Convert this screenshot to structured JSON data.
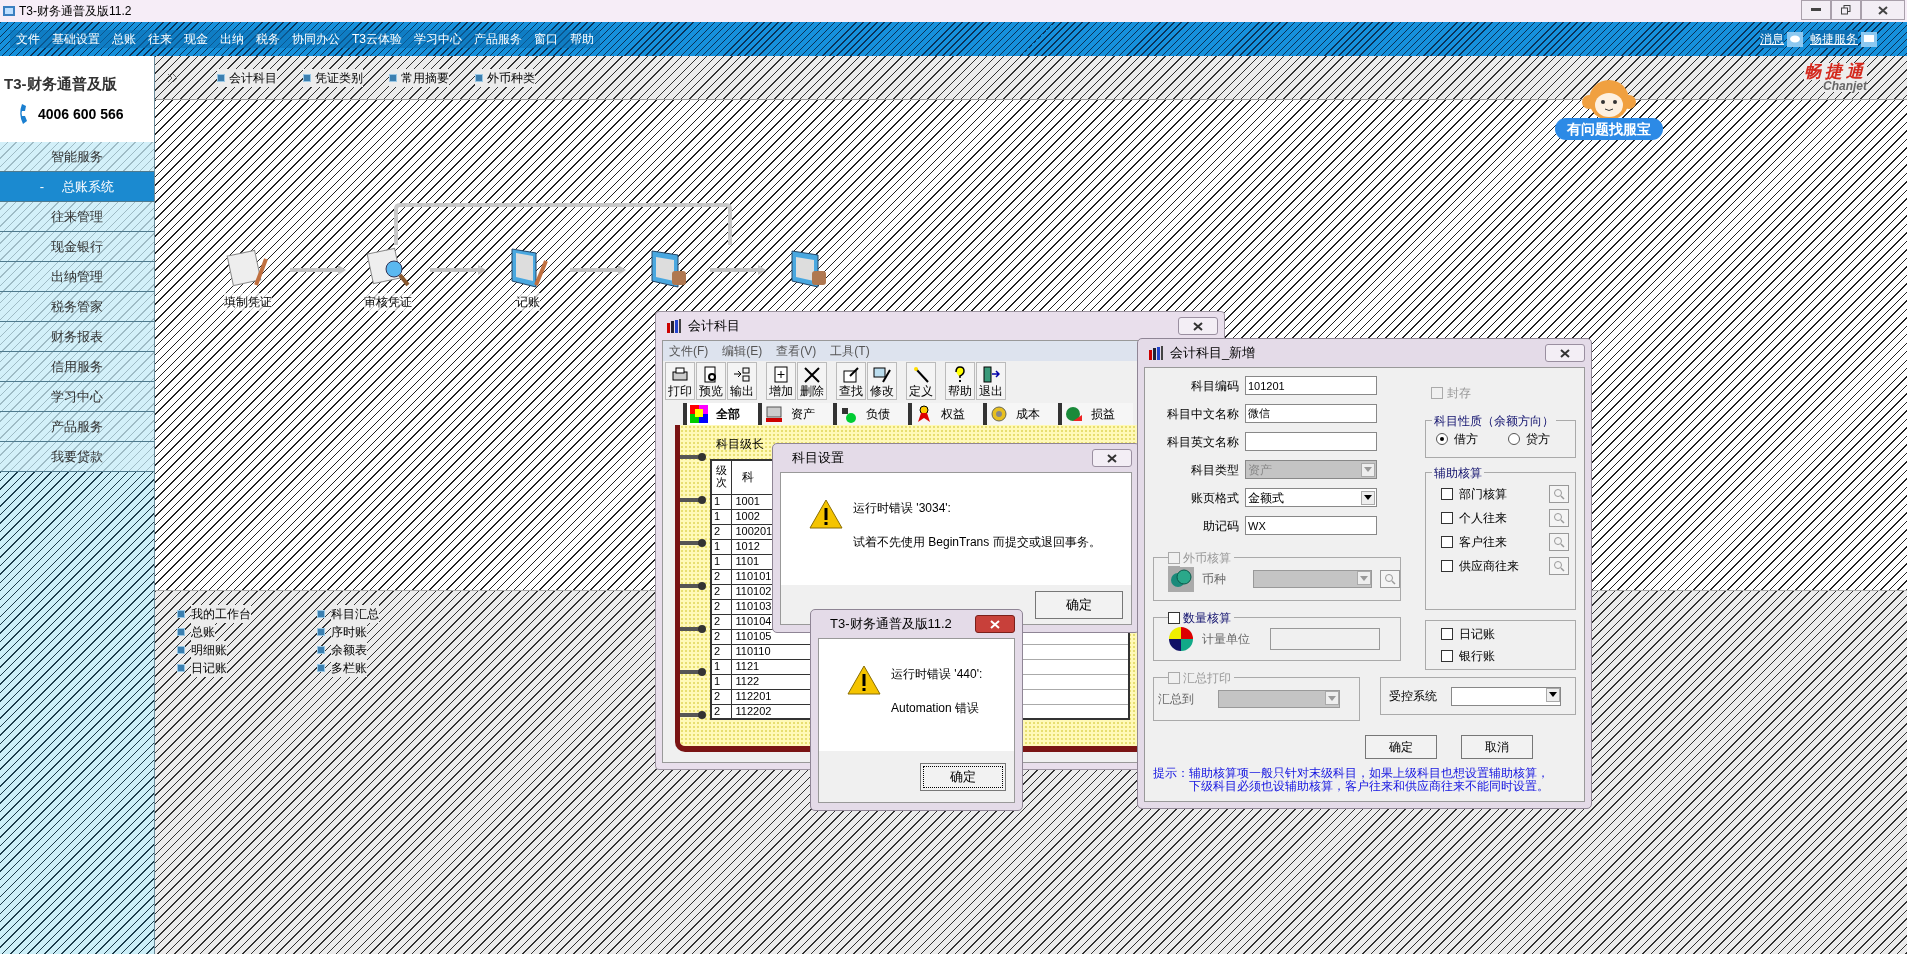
{
  "window": {
    "title": "T3-财务通普及版11.2"
  },
  "menu": [
    "文件",
    "基础设置",
    "总账",
    "往来",
    "现金",
    "出纳",
    "税务",
    "协同办公",
    "T3云体验",
    "学习中心",
    "产品服务",
    "窗口",
    "帮助"
  ],
  "top_links": [
    "消息",
    "畅捷服务"
  ],
  "brand": {
    "product": "T3-财务通普及版",
    "phone": "4006 600 566",
    "logo": "畅捷通",
    "logo_sub": "Chanjet"
  },
  "sidebar": [
    {
      "label": "智能服务",
      "selected": false
    },
    {
      "label": "总账系统",
      "selected": true,
      "bullet": "-"
    },
    {
      "label": "往来管理",
      "selected": false
    },
    {
      "label": "现金银行",
      "selected": false
    },
    {
      "label": "出纳管理",
      "selected": false
    },
    {
      "label": "税务管家",
      "selected": false
    },
    {
      "label": "财务报表",
      "selected": false
    },
    {
      "label": "信用服务",
      "selected": false
    },
    {
      "label": "学习中心",
      "selected": false
    },
    {
      "label": "产品服务",
      "selected": false
    },
    {
      "label": "我要贷款",
      "selected": false
    }
  ],
  "quick_links": [
    "会计科目",
    "凭证类别",
    "常用摘要",
    "外币种类"
  ],
  "helper": {
    "label": "有问题找服宝"
  },
  "workflow": [
    {
      "label": "填制凭证"
    },
    {
      "label": "审核凭证"
    },
    {
      "label": "记账"
    }
  ],
  "bottom_links": [
    "我的工作台",
    "总账",
    "明细账",
    "日记账",
    "科目汇总",
    "序时账",
    "余额表",
    "多栏账"
  ],
  "accounts_window": {
    "title": "会计科目",
    "menu": [
      "文件(F)",
      "编辑(E)",
      "查看(V)",
      "工具(T)"
    ],
    "toolbar": [
      [
        "打印",
        "预览",
        "输出"
      ],
      [
        "增加",
        "删除"
      ],
      [
        "查找",
        "修改"
      ],
      [
        "定义"
      ],
      [
        "帮助",
        "退出"
      ]
    ],
    "tabs": [
      {
        "label": "全部",
        "selected": true
      },
      {
        "label": "资产",
        "selected": false
      },
      {
        "label": "负债",
        "selected": false
      },
      {
        "label": "权益",
        "selected": false
      },
      {
        "label": "成本",
        "selected": false
      },
      {
        "label": "损益",
        "selected": false
      }
    ],
    "level_label": "科目级长",
    "columns": [
      "级次",
      "科"
    ],
    "rows": [
      [
        "1",
        "1001"
      ],
      [
        "1",
        "1002"
      ],
      [
        "2",
        "100201"
      ],
      [
        "1",
        "1012"
      ],
      [
        "1",
        "1101"
      ],
      [
        "2",
        "110101"
      ],
      [
        "2",
        "110102"
      ],
      [
        "2",
        "110103"
      ],
      [
        "2",
        "110104"
      ],
      [
        "2",
        "110105"
      ],
      [
        "2",
        "110110"
      ],
      [
        "1",
        "1121"
      ],
      [
        "1",
        "1122"
      ],
      [
        "2",
        "112201"
      ],
      [
        "2",
        "112202"
      ]
    ]
  },
  "settings_dialog": {
    "title": "科目设置",
    "message": "运行时错误 '3034':",
    "detail": "试着不先使用 BeginTrans 而提交或退回事务。",
    "button": "确定"
  },
  "error_dialog": {
    "title": "T3-财务通普及版11.2",
    "message": "运行时错误 '440':",
    "detail": "Automation 错误",
    "button": "确定"
  },
  "new_account_dialog": {
    "title": "会计科目_新增",
    "fields": [
      {
        "label": "科目编码",
        "kind": "text",
        "value": "101201",
        "disabled": false
      },
      {
        "label": "科目中文名称",
        "kind": "text",
        "value": "微信",
        "disabled": false
      },
      {
        "label": "科目英文名称",
        "kind": "text",
        "disabled": false
      },
      {
        "label": "科目类型",
        "kind": "select",
        "value": "资产",
        "disabled": true
      },
      {
        "label": "账页格式",
        "kind": "select",
        "value": "金额式",
        "disabled": false
      },
      {
        "label": "助记码",
        "kind": "text",
        "value": "WX",
        "disabled": false
      }
    ],
    "archive": {
      "label": "封存",
      "checked": false,
      "disabled": true
    },
    "nature": {
      "title": "科目性质（余额方向）",
      "options": [
        {
          "label": "借方",
          "selected": true
        },
        {
          "label": "贷方",
          "selected": false
        }
      ]
    },
    "auxiliary": {
      "title": "辅助核算",
      "items": [
        {
          "label": "部门核算",
          "checked": false
        },
        {
          "label": "个人往来",
          "checked": false
        },
        {
          "label": "客户往来",
          "checked": false
        },
        {
          "label": "供应商往来",
          "checked": false
        }
      ]
    },
    "foreign": {
      "label": "外币核算",
      "checked": false,
      "disabled": true,
      "field_label": "币种"
    },
    "quantity": {
      "label": "数量核算",
      "checked": false,
      "disabled": false,
      "field_label": "计量单位"
    },
    "summary": {
      "label": "汇总打印",
      "checked": false,
      "disabled": true,
      "field_label": "汇总到"
    },
    "books": [
      {
        "label": "日记账",
        "checked": false
      },
      {
        "label": "银行账",
        "checked": false
      }
    ],
    "controlled": {
      "label": "受控系统"
    },
    "buttons": [
      "确定",
      "取消"
    ],
    "tip_label": "提示：",
    "tip_lines": [
      "辅助核算项一般只针对末级科目，如果上级科目也想设置辅助核算，",
      "下级科目必须也设辅助核算，客户往来和供应商往来不能同时设置。"
    ]
  }
}
